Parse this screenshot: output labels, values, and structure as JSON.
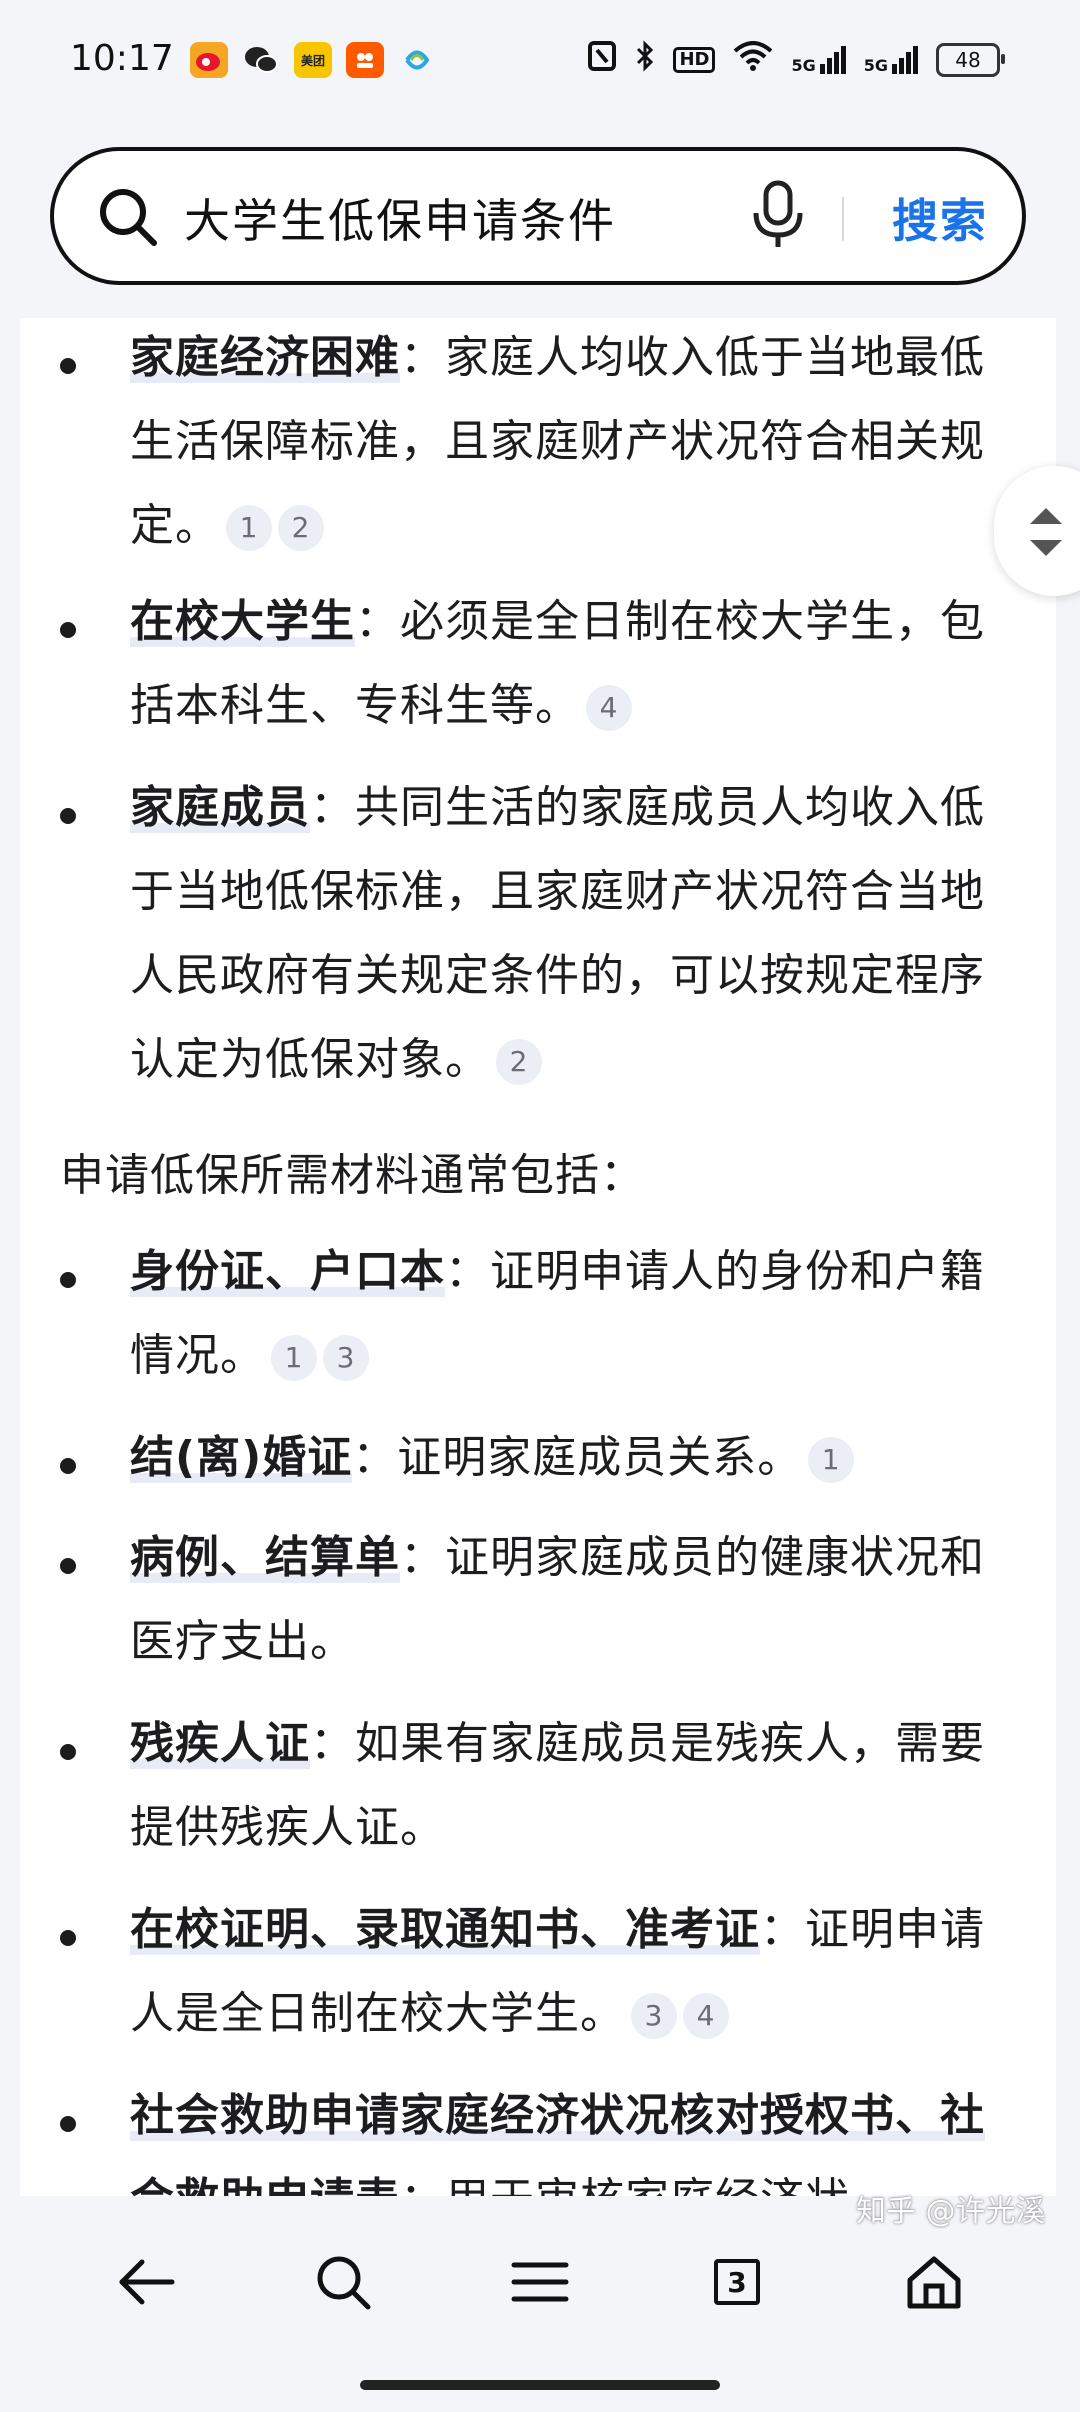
{
  "status_bar": {
    "time": "10:17",
    "battery": "48",
    "network_labels": [
      "HD",
      "5G",
      "5G"
    ]
  },
  "notification_icons": [
    {
      "name": "weibo-icon",
      "color": "#f5a623"
    },
    {
      "name": "wechat-icon",
      "color": "#2b2b2b"
    },
    {
      "name": "meituan-icon",
      "color": "#f7c600",
      "text": "美团"
    },
    {
      "name": "taobao-icon",
      "color": "#ff5a00"
    },
    {
      "name": "china-mobile-icon",
      "color": "#2aa7e8"
    }
  ],
  "search": {
    "query": "大学生低保申请条件",
    "button_label": "搜索"
  },
  "content": {
    "conditions": [
      {
        "bold": "家庭经济困难",
        "text": "：家庭人均收入低于当地最低生活保障标准，且家庭财产状况符合相关规定。",
        "cites": [
          "1",
          "2"
        ]
      },
      {
        "bold": "在校大学生",
        "text": "：必须是全日制在校大学生，包括本科生、专科生等。",
        "cites": [
          "4"
        ]
      },
      {
        "bold": "家庭成员",
        "text": "：共同生活的家庭成员人均收入低于当地低保标准，且家庭财产状况符合当地人民政府有关规定条件的，可以按规定程序认定为低保对象。",
        "cites": [
          "2"
        ]
      }
    ],
    "materials_intro": "申请低保所需材料通常包括：",
    "materials": [
      {
        "bold": "身份证、户口本",
        "text": "：证明申请人的身份和户籍情况。",
        "cites": [
          "1",
          "3"
        ]
      },
      {
        "bold": "结(离)婚证",
        "text": "：证明家庭成员关系。",
        "cites": [
          "1"
        ]
      },
      {
        "bold": "病例、结算单",
        "text": "：证明家庭成员的健康状况和医疗支出。",
        "cites": []
      },
      {
        "bold": "残疾人证",
        "text": "：如果有家庭成员是残疾人，需要提供残疾人证。",
        "cites": []
      },
      {
        "bold": "在校证明、录取通知书、准考证",
        "text": "：证明申请人是全日制在校大学生。",
        "cites": [
          "3",
          "4"
        ]
      },
      {
        "bold": "社会救助申请家庭经济状况核对授权书、社会救助申请表",
        "text": "：用于审核家庭经济状",
        "cites": []
      }
    ]
  },
  "bottom_nav": {
    "tab_count": "3",
    "items": [
      "back-icon",
      "search-icon",
      "menu-icon",
      "tabs-icon",
      "home-icon"
    ]
  },
  "watermark": "知乎 @许光溪"
}
